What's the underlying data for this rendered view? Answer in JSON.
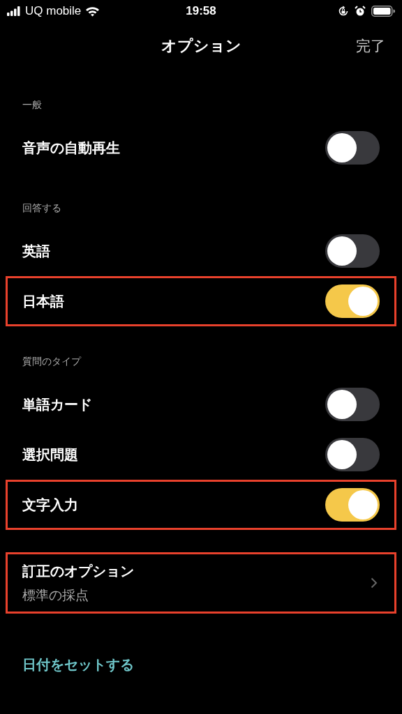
{
  "status_bar": {
    "carrier": "UQ mobile",
    "time": "19:58"
  },
  "nav": {
    "title": "オプション",
    "done": "完了"
  },
  "sections": [
    {
      "header": "一般",
      "items": [
        {
          "kind": "toggle",
          "label": "音声の自動再生",
          "on": false,
          "highlighted": false
        }
      ]
    },
    {
      "header": "回答する",
      "items": [
        {
          "kind": "toggle",
          "label": "英語",
          "on": false,
          "highlighted": false
        },
        {
          "kind": "toggle",
          "label": "日本語",
          "on": true,
          "highlighted": true
        }
      ]
    },
    {
      "header": "質問のタイプ",
      "items": [
        {
          "kind": "toggle",
          "label": "単語カード",
          "on": false,
          "highlighted": false
        },
        {
          "kind": "toggle",
          "label": "選択問題",
          "on": false,
          "highlighted": false
        },
        {
          "kind": "toggle",
          "label": "文字入力",
          "on": true,
          "highlighted": true
        }
      ]
    },
    {
      "items": [
        {
          "kind": "link",
          "label": "訂正のオプション",
          "value": "標準の採点",
          "highlighted": true
        }
      ]
    },
    {
      "items": [
        {
          "kind": "action",
          "label": "日付をセットする"
        }
      ]
    }
  ]
}
